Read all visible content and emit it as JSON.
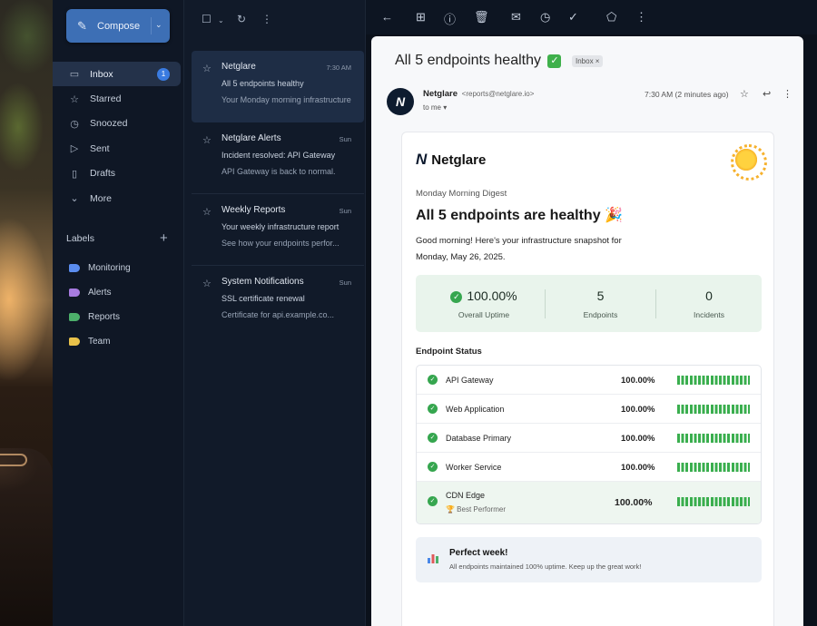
{
  "colors": {
    "accent": "#3d6fb5",
    "success": "#36a64f",
    "badge": "#3a7be0"
  },
  "compose": {
    "label": "Compose"
  },
  "nav": {
    "items": [
      {
        "label": "Inbox",
        "icon": "inbox-icon",
        "badge": "1",
        "active": true
      },
      {
        "label": "Starred",
        "icon": "star-icon"
      },
      {
        "label": "Snoozed",
        "icon": "clock-icon"
      },
      {
        "label": "Sent",
        "icon": "send-icon"
      },
      {
        "label": "Drafts",
        "icon": "draft-icon"
      },
      {
        "label": "More",
        "icon": "chevron-down-icon"
      }
    ]
  },
  "labels": {
    "title": "Labels",
    "items": [
      {
        "label": "Monitoring",
        "color": "#5b8def"
      },
      {
        "label": "Alerts",
        "color": "#a77be0"
      },
      {
        "label": "Reports",
        "color": "#4caf6a"
      },
      {
        "label": "Team",
        "color": "#e9c24a"
      }
    ]
  },
  "mails": [
    {
      "from": "Netglare",
      "time": "7:30 AM",
      "subject": "All 5 endpoints healthy",
      "preview": "Your Monday morning infrastructure",
      "selected": true
    },
    {
      "from": "Netglare Alerts",
      "time": "Sun",
      "subject": "Incident resolved: API Gateway",
      "preview": "API Gateway is back to normal."
    },
    {
      "from": "Weekly Reports",
      "time": "Sun",
      "subject": "Your weekly infrastructure report",
      "preview": "See how your endpoints perfor..."
    },
    {
      "from": "System Notifications",
      "time": "Sun",
      "subject": "SSL certificate renewal",
      "preview": "Certificate for api.example.co..."
    }
  ],
  "message": {
    "subject": "All 5 endpoints healthy",
    "chip": "Inbox ×",
    "avatar": "N",
    "sender_name": "Netglare",
    "sender_email": "<reports@netglare.io>",
    "to": "to me ▾",
    "time": "7:30 AM (2 minutes ago)"
  },
  "email": {
    "brand": "Netglare",
    "digest": "Monday Morning Digest",
    "headline": "All 5 endpoints are healthy 🎉",
    "greeting": "Good morning! Here's your infrastructure snapshot for Monday, May 26, 2025.",
    "stats": [
      {
        "value": "100.00%",
        "label": "Overall Uptime"
      },
      {
        "value": "5",
        "label": "Endpoints"
      },
      {
        "value": "0",
        "label": "Incidents"
      }
    ],
    "status_title": "Endpoint Status",
    "endpoints": [
      {
        "name": "API Gateway",
        "uptime": "100.00%"
      },
      {
        "name": "Web Application",
        "uptime": "100.00%"
      },
      {
        "name": "Database Primary",
        "uptime": "100.00%"
      },
      {
        "name": "Worker Service",
        "uptime": "100.00%"
      },
      {
        "name": "CDN Edge",
        "uptime": "100.00%",
        "note": "🏆 Best Performer"
      }
    ],
    "perfect_title": "Perfect week!",
    "perfect_desc": "All endpoints maintained 100% uptime. Keep up the great work!"
  }
}
